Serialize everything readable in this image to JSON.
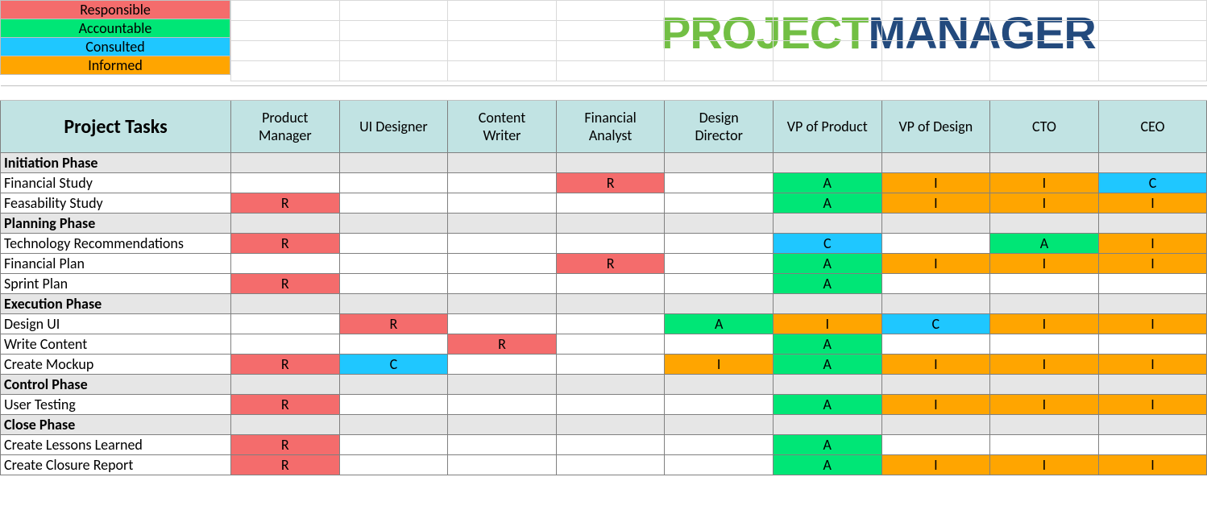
{
  "brand": {
    "left": "PROJECT",
    "right": "MANAGER"
  },
  "legend": {
    "R": "Responsible",
    "A": "Accountable",
    "C": "Consulted",
    "I": "Informed"
  },
  "colors": {
    "R": "#f46c6c",
    "A": "#00e676",
    "C": "#1fc7ff",
    "I": "#ffa500"
  },
  "header": {
    "tasks_label": "Project Tasks",
    "roles": [
      "Product Manager",
      "UI Designer",
      "Content Writer",
      "Financial Analyst",
      "Design Director",
      "VP of Product",
      "VP of Design",
      "CTO",
      "CEO"
    ]
  },
  "phases": [
    {
      "name": "Initiation Phase",
      "tasks": [
        {
          "name": "Financial Study",
          "cells": [
            "",
            "",
            "",
            "R",
            "",
            "A",
            "I",
            "I",
            "C"
          ]
        },
        {
          "name": "Feasability Study",
          "cells": [
            "R",
            "",
            "",
            "",
            "",
            "A",
            "I",
            "I",
            "I"
          ]
        }
      ]
    },
    {
      "name": "Planning Phase",
      "tasks": [
        {
          "name": "Technology Recommendations",
          "cells": [
            "R",
            "",
            "",
            "",
            "",
            "C",
            "",
            "A",
            "I"
          ]
        },
        {
          "name": "Financial Plan",
          "cells": [
            "",
            "",
            "",
            "R",
            "",
            "A",
            "I",
            "I",
            "I"
          ]
        },
        {
          "name": "Sprint Plan",
          "cells": [
            "R",
            "",
            "",
            "",
            "",
            "A",
            "",
            "",
            ""
          ]
        }
      ]
    },
    {
      "name": "Execution Phase",
      "tasks": [
        {
          "name": "Design UI",
          "cells": [
            "",
            "R",
            "",
            "",
            "A",
            "I",
            "C",
            "I",
            "I"
          ]
        },
        {
          "name": "Write Content",
          "cells": [
            "",
            "",
            "R",
            "",
            "",
            "A",
            "",
            "",
            ""
          ]
        },
        {
          "name": "Create Mockup",
          "cells": [
            "R",
            "C",
            "",
            "",
            "I",
            "A",
            "I",
            "I",
            "I"
          ]
        }
      ]
    },
    {
      "name": "Control Phase",
      "tasks": [
        {
          "name": "User Testing",
          "cells": [
            "R",
            "",
            "",
            "",
            "",
            "A",
            "I",
            "I",
            "I"
          ]
        }
      ]
    },
    {
      "name": "Close Phase",
      "tasks": [
        {
          "name": "Create Lessons Learned",
          "cells": [
            "R",
            "",
            "",
            "",
            "",
            "A",
            "",
            "",
            ""
          ]
        },
        {
          "name": "Create Closure Report",
          "cells": [
            "R",
            "",
            "",
            "",
            "",
            "A",
            "I",
            "I",
            "I"
          ]
        }
      ]
    }
  ]
}
